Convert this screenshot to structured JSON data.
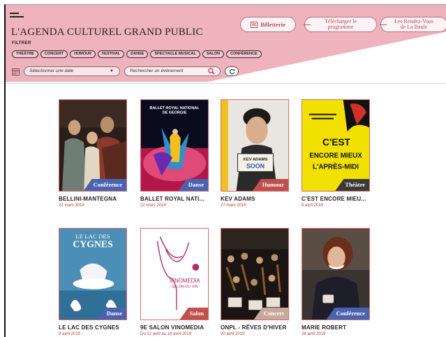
{
  "header": {
    "title": "L'AGENDA CULTUREL GRAND PUBLIC",
    "filter_label": "FILTRER",
    "billetterie": "Billetterie",
    "telecharger_1": "Télécharger le",
    "telecharger_2": "programme",
    "rdv_1": "Les Rendez-Vous",
    "rdv_2": "de La Baule"
  },
  "tags": [
    "THÉÂTRE",
    "CONCERT",
    "HUMOUR",
    "FESTIVAL",
    "DANSE",
    "SPECTACLE MUSICAL",
    "SALON",
    "CONFÉRENCE"
  ],
  "filters": {
    "date_placeholder": "Sélectionner une date",
    "search_placeholder": "Rechercher un événement"
  },
  "colors": {
    "accent": "#e8a1ad",
    "badge": "#4a63b0",
    "badge_salon": "#c0504d",
    "badge_concert": "#c8a89a",
    "date_red": "#c0392b"
  },
  "events": [
    {
      "name": "BELLINI-MANTEGNA",
      "date": "22 mars 2019",
      "category": "Conférence"
    },
    {
      "name": "BALLET ROYAL NATI...",
      "date": "22 mars 2019",
      "category": "Danse"
    },
    {
      "name": "KEV ADAMS",
      "date": "27 mars 2019",
      "category": "Humour"
    },
    {
      "name": "C'EST ENCORE MIEU...",
      "date": "6 avril 2019",
      "category": "Théâtre"
    },
    {
      "name": "LE LAC DES CYGNES",
      "date": "9 avril 2019",
      "category": "Danse"
    },
    {
      "name": "9E SALON VINOMEDIA",
      "date": "Du 12 avril au 14 avril 2019",
      "category": "Salon"
    },
    {
      "name": "ONPL - RÊVES D'HIVER",
      "date": "20 avril 2019",
      "category": "Concert"
    },
    {
      "name": "MARIE ROBERT",
      "date": "26 avril 2019",
      "category": "Conférence"
    }
  ],
  "posters": {
    "ballet_line1": "BALLET ROYAL NATIONAL",
    "ballet_line2": "DE GEORGIE",
    "kev_sign1": "KEV ADAMS",
    "kev_sign2": "SOON",
    "mieux_1": "C'EST",
    "mieux_2": "ENCORE MIEUX",
    "mieux_3": "L'APRÈS-MIDI",
    "lac_1": "LE LAC DES",
    "lac_2": "CYGNES",
    "vino_1": "VINOMEDIA",
    "vino_2": "SALON DU VIN"
  }
}
